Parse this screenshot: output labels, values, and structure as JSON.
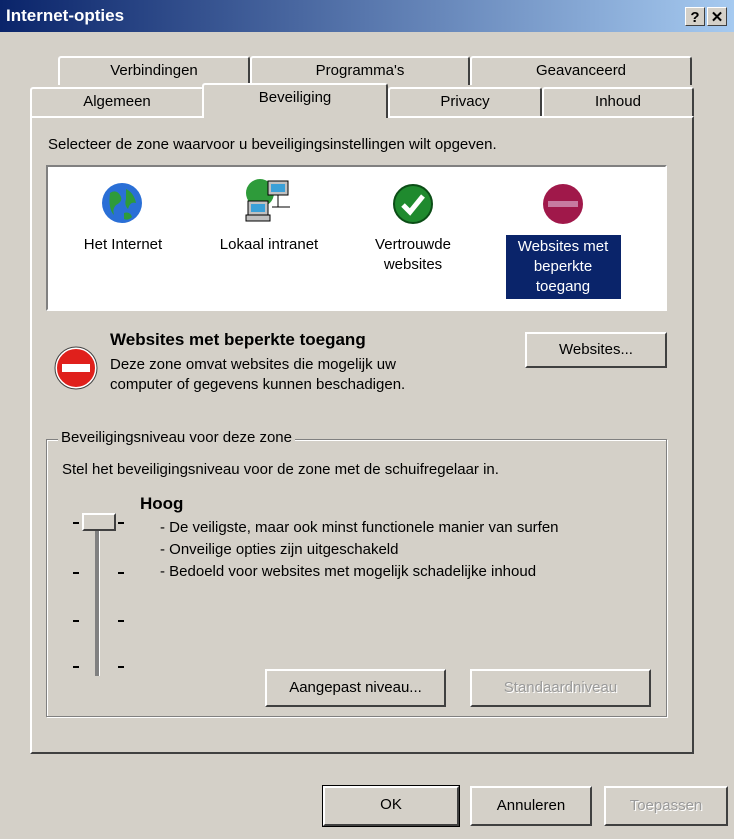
{
  "window": {
    "title": "Internet-opties",
    "help_label": "?",
    "close_label": "✕"
  },
  "tabs": {
    "row1": [
      "Verbindingen",
      "Programma's",
      "Geavanceerd"
    ],
    "row2": [
      "Algemeen",
      "Beveiliging",
      "Privacy",
      "Inhoud"
    ],
    "active": "Beveiliging"
  },
  "security": {
    "instruction": "Selecteer de zone waarvoor u beveiligingsinstellingen wilt opgeven.",
    "zones": [
      {
        "label": "Het Internet",
        "icon": "globe-icon"
      },
      {
        "label": "Lokaal intranet",
        "icon": "network-computers-icon"
      },
      {
        "label": "Vertrouwde websites",
        "icon": "checkmark-icon"
      },
      {
        "label": "Websites met beperkte toegang",
        "icon": "restricted-icon",
        "selected": true
      }
    ],
    "zone_title": "Websites met beperkte toegang",
    "zone_desc_line1": "Deze zone omvat websites die mogelijk uw",
    "zone_desc_line2": "computer of gegevens kunnen beschadigen.",
    "websites_button": "Websites...",
    "level_group_label": "Beveiligingsniveau voor deze zone",
    "level_instruction": "Stel het beveiligingsniveau voor de zone met de schuifregelaar in.",
    "level_name": "Hoog",
    "level_points": [
      "- De veiligste, maar ook minst functionele manier van surfen",
      "- Onveilige opties zijn uitgeschakeld",
      "- Bedoeld voor websites met mogelijk schadelijke inhoud"
    ],
    "custom_level_button": "Aangepast niveau...",
    "default_level_button": "Standaardniveau",
    "slider_level": "1 of 4"
  },
  "footer": {
    "ok": "OK",
    "cancel": "Annuleren",
    "apply": "Toepassen"
  }
}
